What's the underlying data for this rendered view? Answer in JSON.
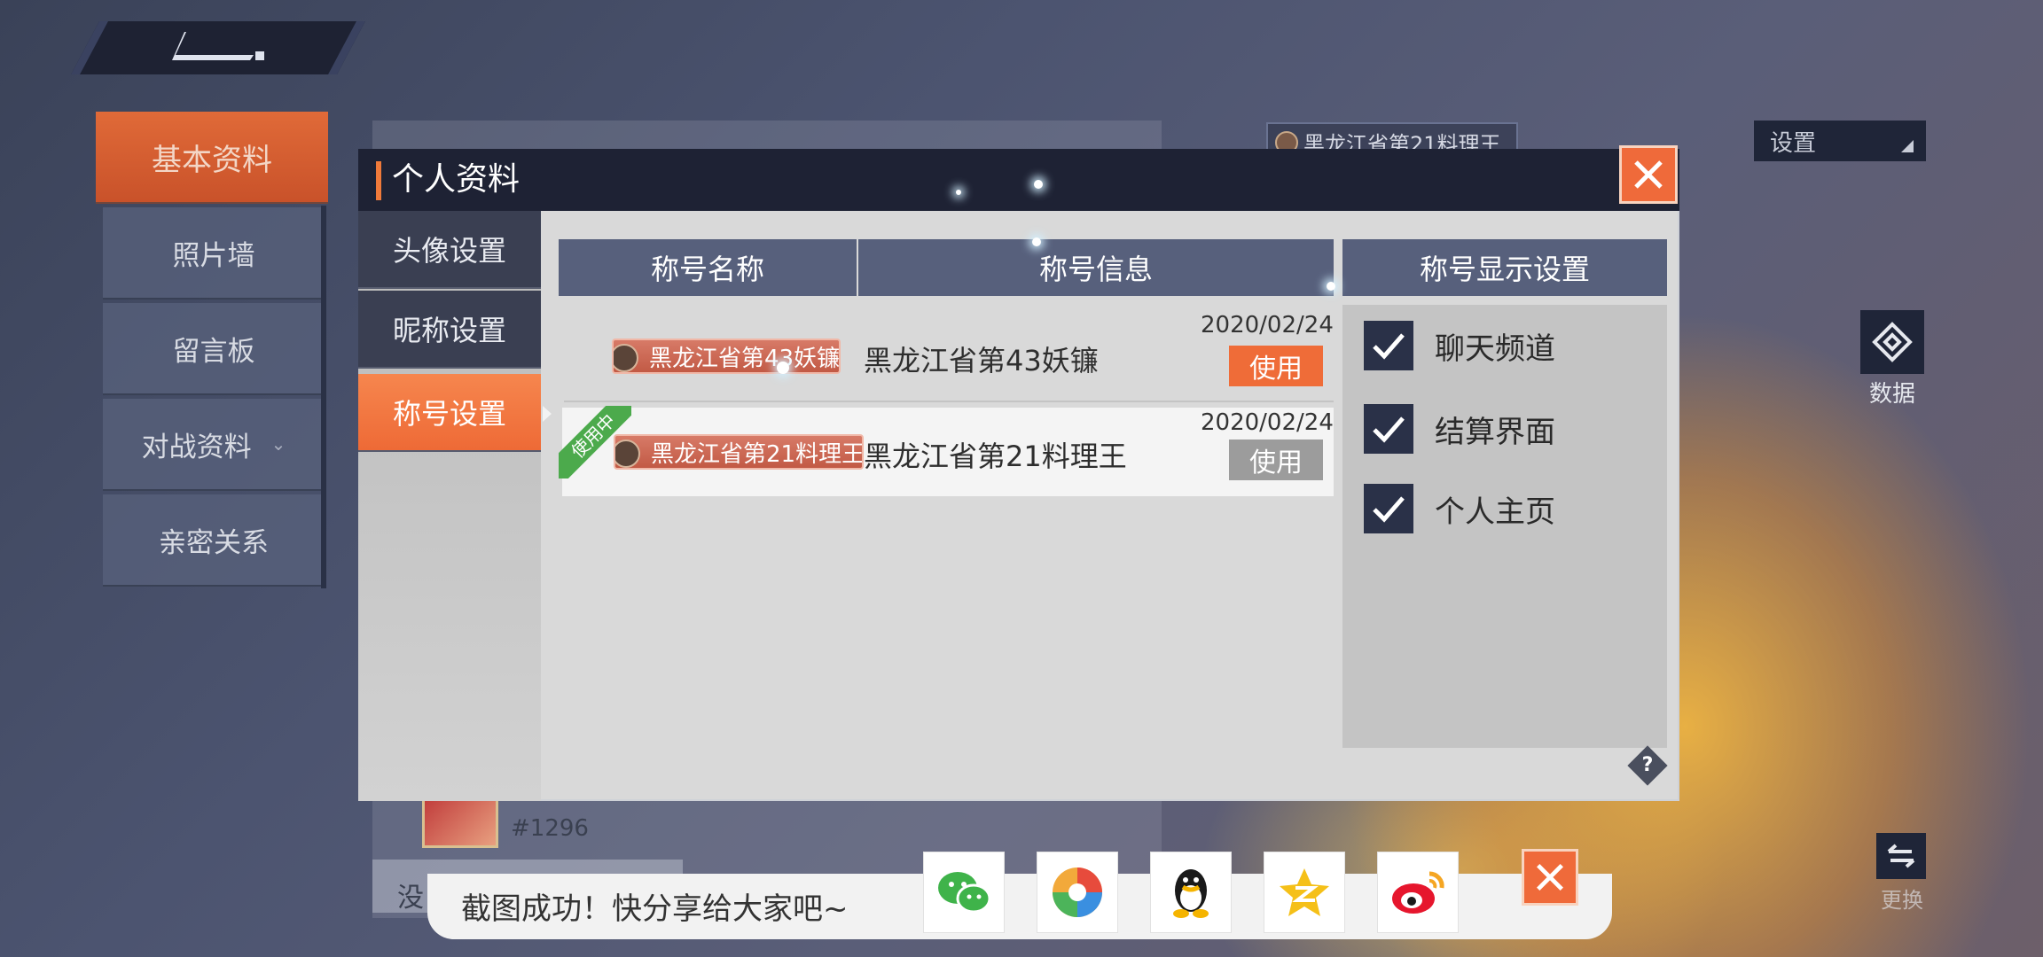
{
  "background_page": {
    "sidebar": {
      "tabs": [
        {
          "label": "基本资料",
          "active": true
        },
        {
          "label": "照片墙"
        },
        {
          "label": "留言板"
        },
        {
          "label": "对战资料"
        },
        {
          "label": "亲密关系"
        }
      ]
    },
    "equipped_title_chip": "黑龙江省第21料理王",
    "settings_dropdown": "设置",
    "data_button_label": "数据",
    "swap_button_label": "更换",
    "friend_id": "#1296",
    "truncated_text": "没"
  },
  "modal": {
    "title": "个人资料",
    "nav": [
      {
        "label": "头像设置"
      },
      {
        "label": "昵称设置"
      },
      {
        "label": "称号设置",
        "active": true
      }
    ],
    "table": {
      "headers": [
        "称号名称",
        "称号信息"
      ],
      "rows": [
        {
          "badge": "黑龙江省第43妖镰",
          "info": "黑龙江省第43妖镰",
          "date": "2020/02/24",
          "action": "使用",
          "in_use": false
        },
        {
          "badge": "黑龙江省第21料理王",
          "info": "黑龙江省第21料理王",
          "date": "2020/02/24",
          "action": "使用",
          "in_use": true,
          "ribbon": "使用中"
        }
      ]
    },
    "display_settings": {
      "header": "称号显示设置",
      "options": [
        {
          "label": "聊天频道",
          "checked": true
        },
        {
          "label": "结算界面",
          "checked": true
        },
        {
          "label": "个人主页",
          "checked": true
        }
      ]
    },
    "help_icon": "?"
  },
  "share_bar": {
    "text": "截图成功！快分享给大家吧~",
    "targets": [
      "wechat-icon",
      "moments-icon",
      "qq-icon",
      "qzone-icon",
      "weibo-icon"
    ]
  },
  "colors": {
    "accent": "#ef6a3a",
    "header_blue": "#57607c",
    "dark_panel": "#1e2234",
    "in_use_green": "#4caa4c"
  }
}
